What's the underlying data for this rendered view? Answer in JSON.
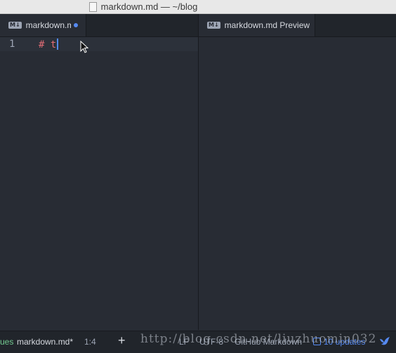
{
  "window": {
    "title": "markdown.md — ~/blog"
  },
  "editor_tab": {
    "label": "markdown.md",
    "icon": "markdown-icon",
    "modified": true
  },
  "preview_tab": {
    "label": "markdown.md Preview",
    "icon": "markdown-icon"
  },
  "editor": {
    "lines": [
      {
        "number": "1",
        "text": "# t"
      }
    ]
  },
  "status_bar": {
    "issues": "ues",
    "file": "markdown.md*",
    "cursor_position": "1:4",
    "add": "+",
    "line_ending": "LF",
    "encoding": "UTF-8",
    "grammar": "GitHub Markdown",
    "updates": "10 updates"
  },
  "watermark": "http://blog.csdn.net/liuzhuomin032",
  "colors": {
    "accent": "#568af2",
    "heading": "#e06c75",
    "background": "#282c34"
  }
}
